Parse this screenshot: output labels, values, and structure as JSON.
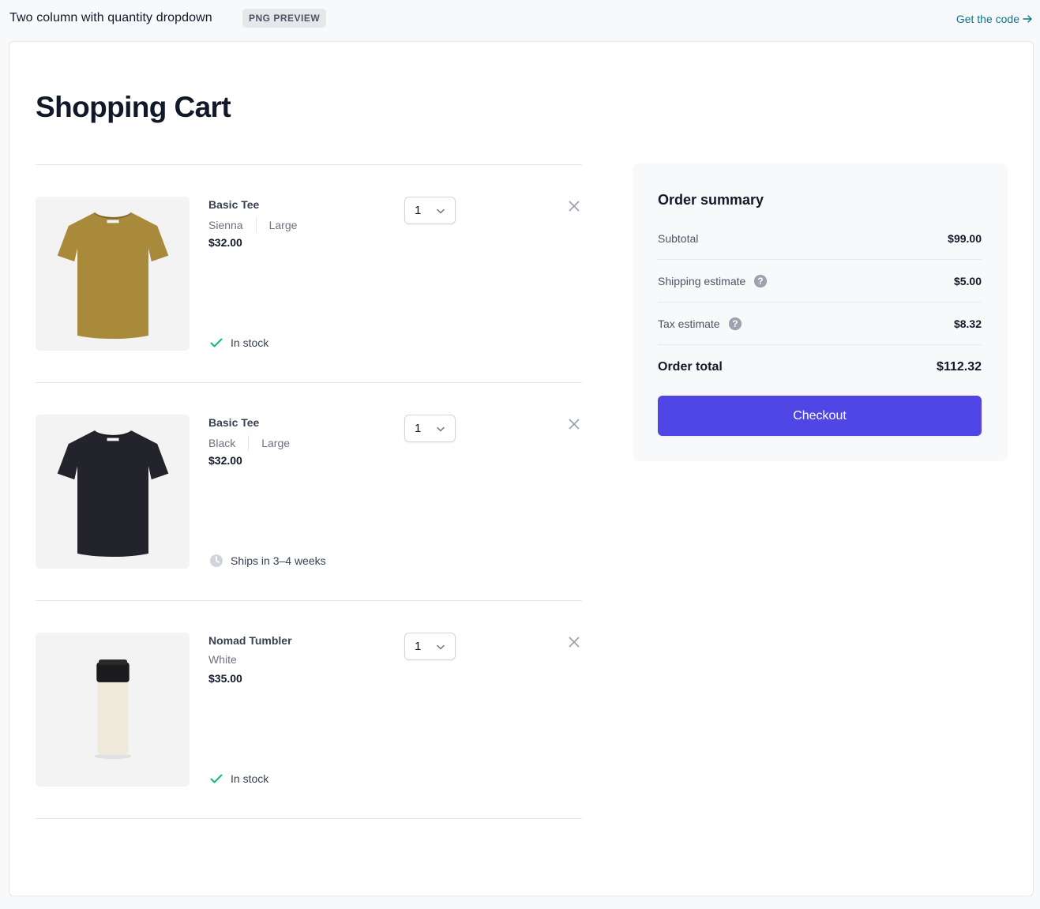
{
  "header": {
    "title": "Two column with quantity dropdown",
    "badge": "PNG PREVIEW",
    "code_link": "Get the code"
  },
  "page": {
    "title": "Shopping Cart"
  },
  "cart": {
    "items": [
      {
        "name": "Basic Tee",
        "color": "Sienna",
        "size": "Large",
        "price": "$32.00",
        "quantity": "1",
        "status": "In stock",
        "status_type": "in-stock",
        "swatch": "#a98a3b",
        "image": "tshirt"
      },
      {
        "name": "Basic Tee",
        "color": "Black",
        "size": "Large",
        "price": "$32.00",
        "quantity": "1",
        "status": "Ships in 3–4 weeks",
        "status_type": "ships-later",
        "swatch": "#22232b",
        "image": "tshirt"
      },
      {
        "name": "Nomad Tumbler",
        "color": "White",
        "size": "",
        "price": "$35.00",
        "quantity": "1",
        "status": "In stock",
        "status_type": "in-stock",
        "swatch": "#efe9dc",
        "image": "tumbler"
      }
    ]
  },
  "summary": {
    "title": "Order summary",
    "subtotal_label": "Subtotal",
    "subtotal_value": "$99.00",
    "shipping_label": "Shipping estimate",
    "shipping_value": "$5.00",
    "tax_label": "Tax estimate",
    "tax_value": "$8.32",
    "total_label": "Order total",
    "total_value": "$112.32",
    "checkout_label": "Checkout"
  },
  "colors": {
    "accent": "#4f46e5",
    "success": "#10b981",
    "link": "#0e7490"
  }
}
